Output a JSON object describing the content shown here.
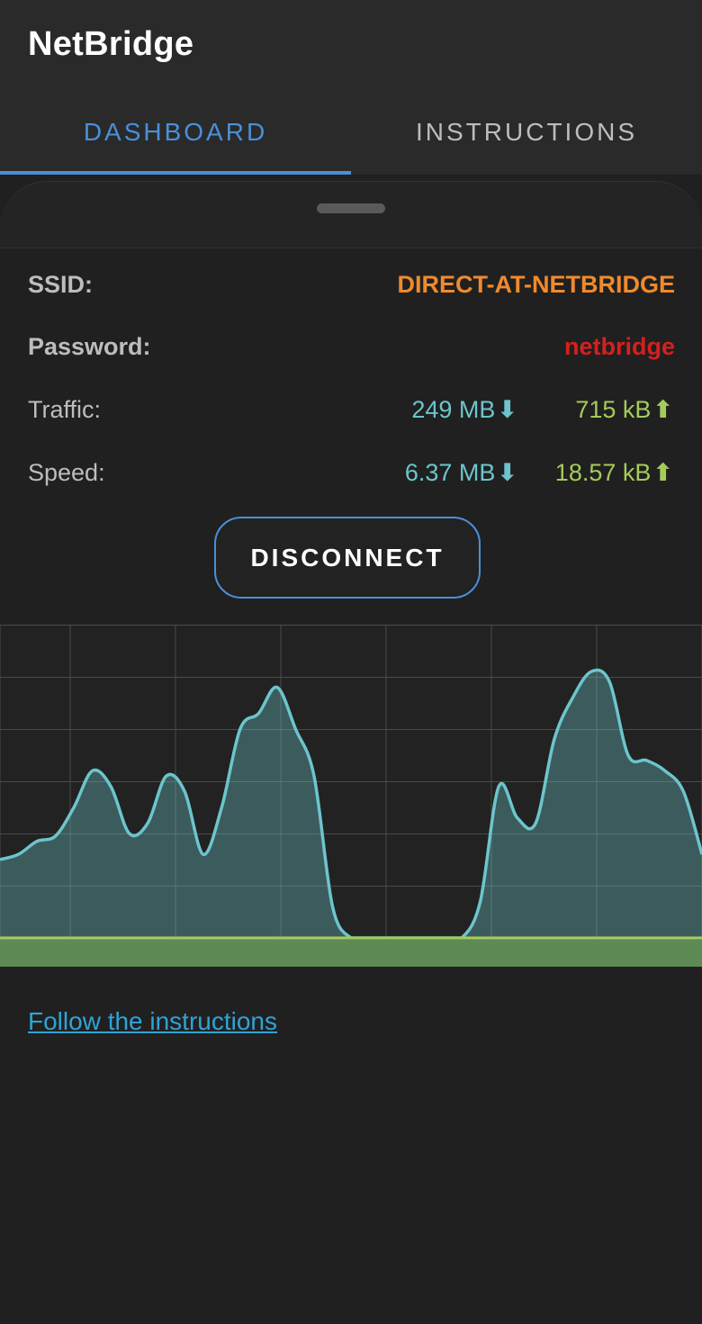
{
  "app": {
    "title": "NetBridge"
  },
  "tabs": [
    {
      "label": "DASHBOARD",
      "active": true
    },
    {
      "label": "INSTRUCTIONS",
      "active": false
    }
  ],
  "info": {
    "ssid_label": "SSID:",
    "ssid_value": "DIRECT-AT-NETBRIDGE",
    "password_label": "Password:",
    "password_value": "netbridge",
    "traffic_label": "Traffic:",
    "traffic_down": "249 MB",
    "traffic_up": "715 kB",
    "speed_label": "Speed:",
    "speed_down": "6.37 MB",
    "speed_up": "18.57 kB"
  },
  "icons": {
    "down": "arrow-down-icon",
    "up": "arrow-up-icon"
  },
  "colors": {
    "accent": "#4a90d9",
    "ssid": "#f08a2c",
    "password": "#d61f1f",
    "download": "#6cc5cc",
    "upload": "#a4cc5a",
    "link": "#2fa3d6"
  },
  "button": {
    "label": "DISCONNECT"
  },
  "link": {
    "label": "Follow the instructions"
  },
  "chart_data": {
    "type": "area",
    "title": "",
    "xlabel": "",
    "ylabel": "",
    "grid": true,
    "ylim": [
      0,
      6
    ],
    "series": [
      {
        "color": "#6cc5cc",
        "values": [
          1.5,
          1.6,
          1.85,
          1.95,
          2.5,
          3.2,
          2.9,
          2.0,
          2.2,
          3.1,
          2.8,
          1.6,
          2.5,
          4.0,
          4.3,
          4.8,
          4.0,
          3.1,
          0.6,
          0,
          0,
          0,
          0,
          0,
          0,
          0,
          0.7,
          2.9,
          2.3,
          2.2,
          3.8,
          4.6,
          5.1,
          4.9,
          3.5,
          3.4,
          3.2,
          2.8,
          1.6
        ]
      },
      {
        "color": "#a4cc5a",
        "values": [
          0,
          0,
          0,
          0,
          0,
          0,
          0,
          0,
          0,
          0,
          0,
          0,
          0,
          0,
          0,
          0,
          0,
          0,
          0,
          0,
          0,
          0,
          0,
          0,
          0,
          0,
          0,
          0,
          0,
          0,
          0,
          0,
          0,
          0,
          0,
          0,
          0,
          0,
          0
        ]
      }
    ]
  }
}
